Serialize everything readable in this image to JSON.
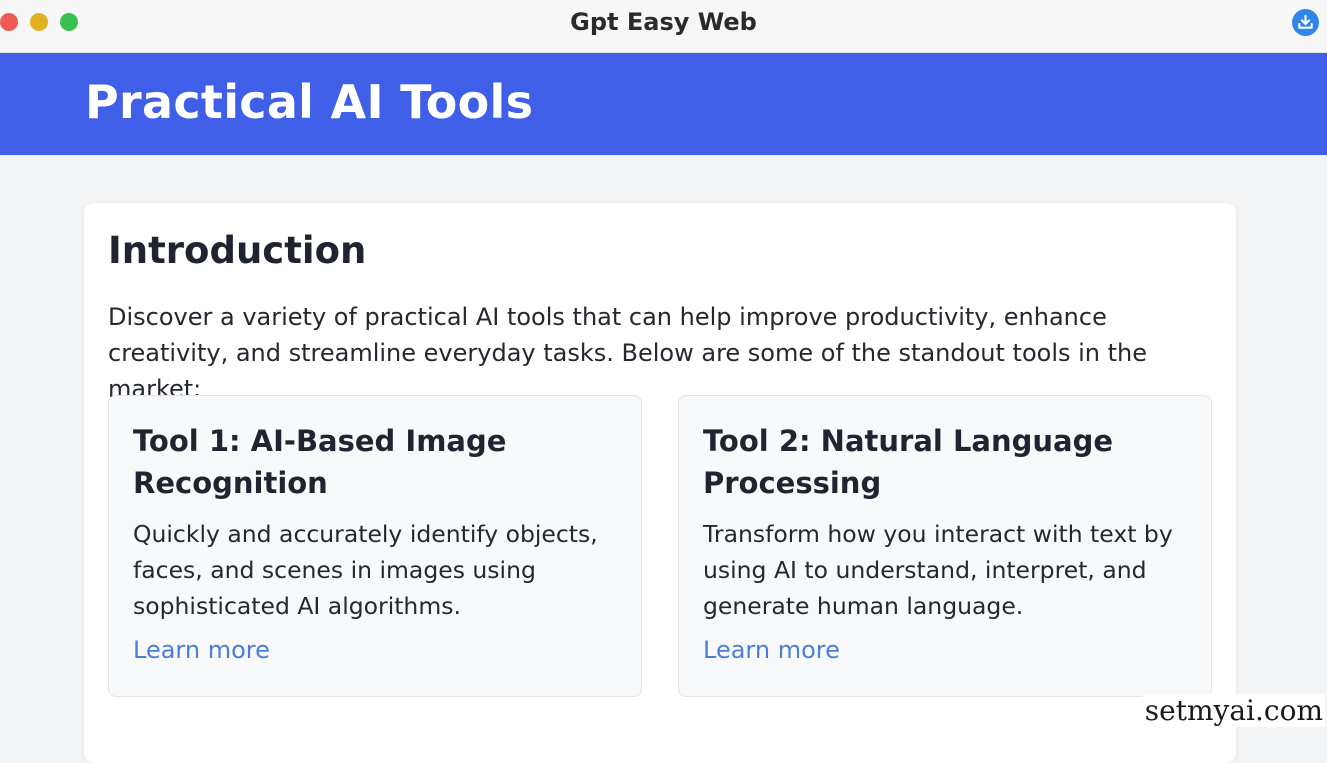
{
  "window": {
    "title": "Gpt Easy Web",
    "controls": [
      "close",
      "minimize",
      "maximize"
    ],
    "action_icon": "download-icon"
  },
  "header": {
    "title": "Practical AI Tools",
    "color": "#3f5fe8"
  },
  "intro": {
    "title": "Introduction",
    "text": "Discover a variety of practical AI tools that can help improve productivity, enhance creativity, and streamline everyday tasks. Below are some of the standout tools in the market:"
  },
  "tools": [
    {
      "title": "Tool 1: AI-Based Image Recognition",
      "description": "Quickly and accurately identify objects, faces, and scenes in images using sophisticated AI algorithms.",
      "link_label": "Learn more"
    },
    {
      "title": "Tool 2: Natural Language Processing",
      "description": "Transform how you interact with text by using AI to understand, interpret, and generate human language.",
      "link_label": "Learn more"
    }
  ],
  "watermark": "setmyai.com",
  "colors": {
    "accent": "#3f5fe8",
    "link": "#4b7fd6",
    "download": "#2f86e8"
  }
}
